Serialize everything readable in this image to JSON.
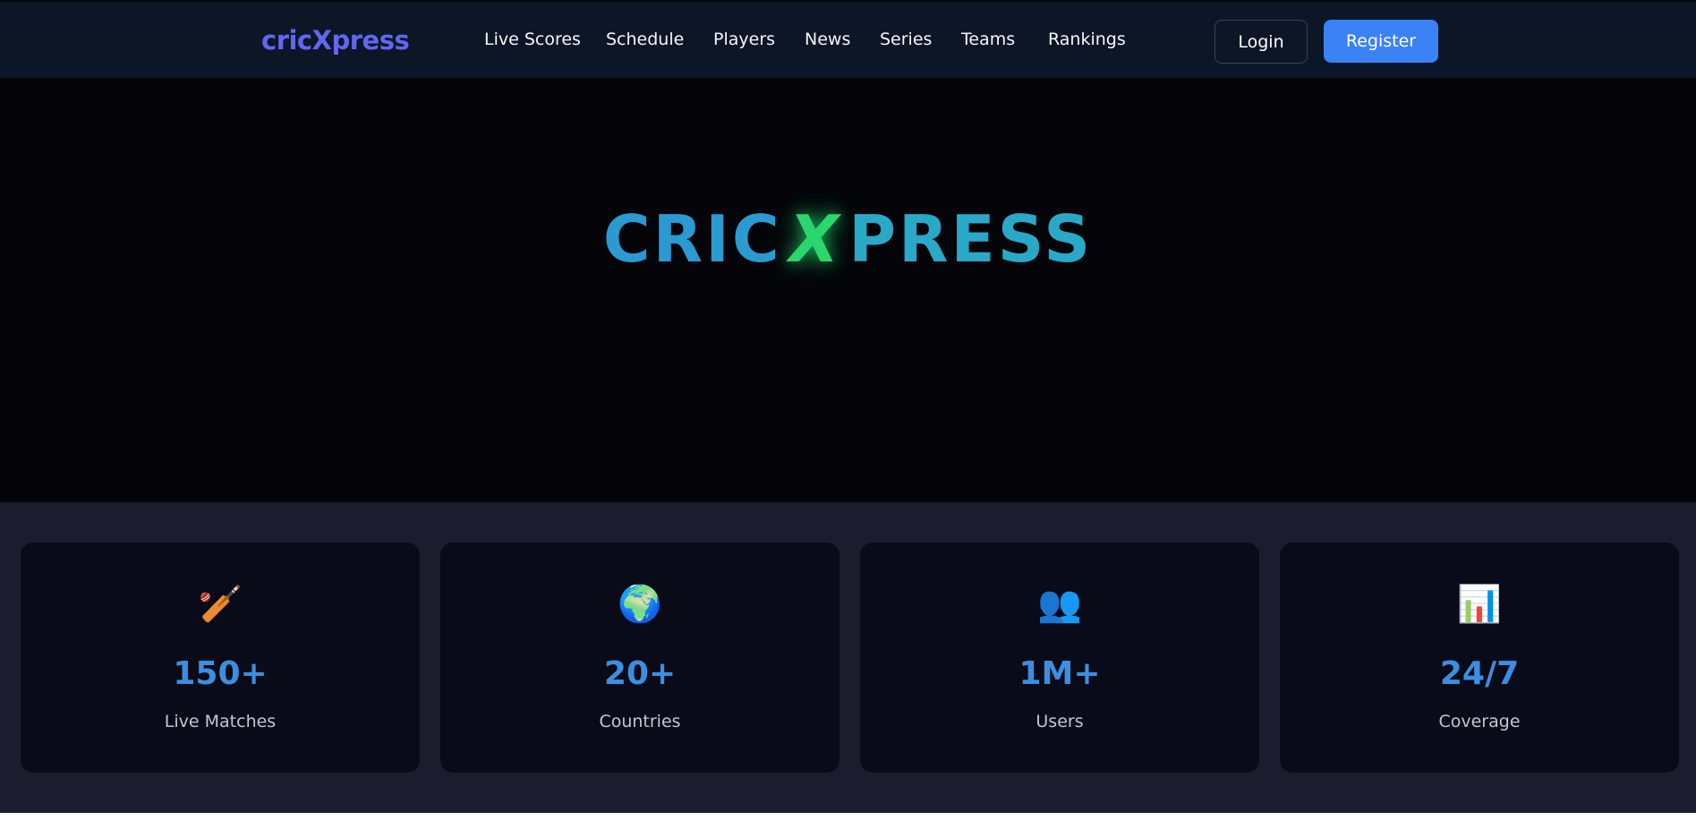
{
  "navbar": {
    "brand": "cricXpress",
    "links": [
      "Live Scores",
      "Schedule",
      "Players",
      "News",
      "Series",
      "Teams",
      "Rankings"
    ],
    "login_label": "Login",
    "register_label": "Register"
  },
  "hero": {
    "logo_part_a": "CRIC",
    "logo_part_x": "X",
    "logo_part_b": "PRESS"
  },
  "stats": [
    {
      "icon": "cricket-bat-icon",
      "glyph": "🏏",
      "value": "150+",
      "label": "Live Matches"
    },
    {
      "icon": "globe-icon",
      "glyph": "🌍",
      "value": "20+",
      "label": "Countries"
    },
    {
      "icon": "users-icon",
      "glyph": "👥",
      "value": "1M+",
      "label": "Users"
    },
    {
      "icon": "bar-chart-icon",
      "glyph": "📊",
      "value": "24/7",
      "label": "Coverage"
    }
  ],
  "colors": {
    "navbar_bg": "#0d1627",
    "brand": "#6366f1",
    "register_bg": "#3b82f6",
    "hero_bg": "#040409",
    "logo_blue": "#2a9ad0",
    "logo_green": "#2bd66f",
    "stats_bg": "#1b1c2e",
    "card_bg": "#0a0b18",
    "stat_value": "#3b8fe0"
  }
}
